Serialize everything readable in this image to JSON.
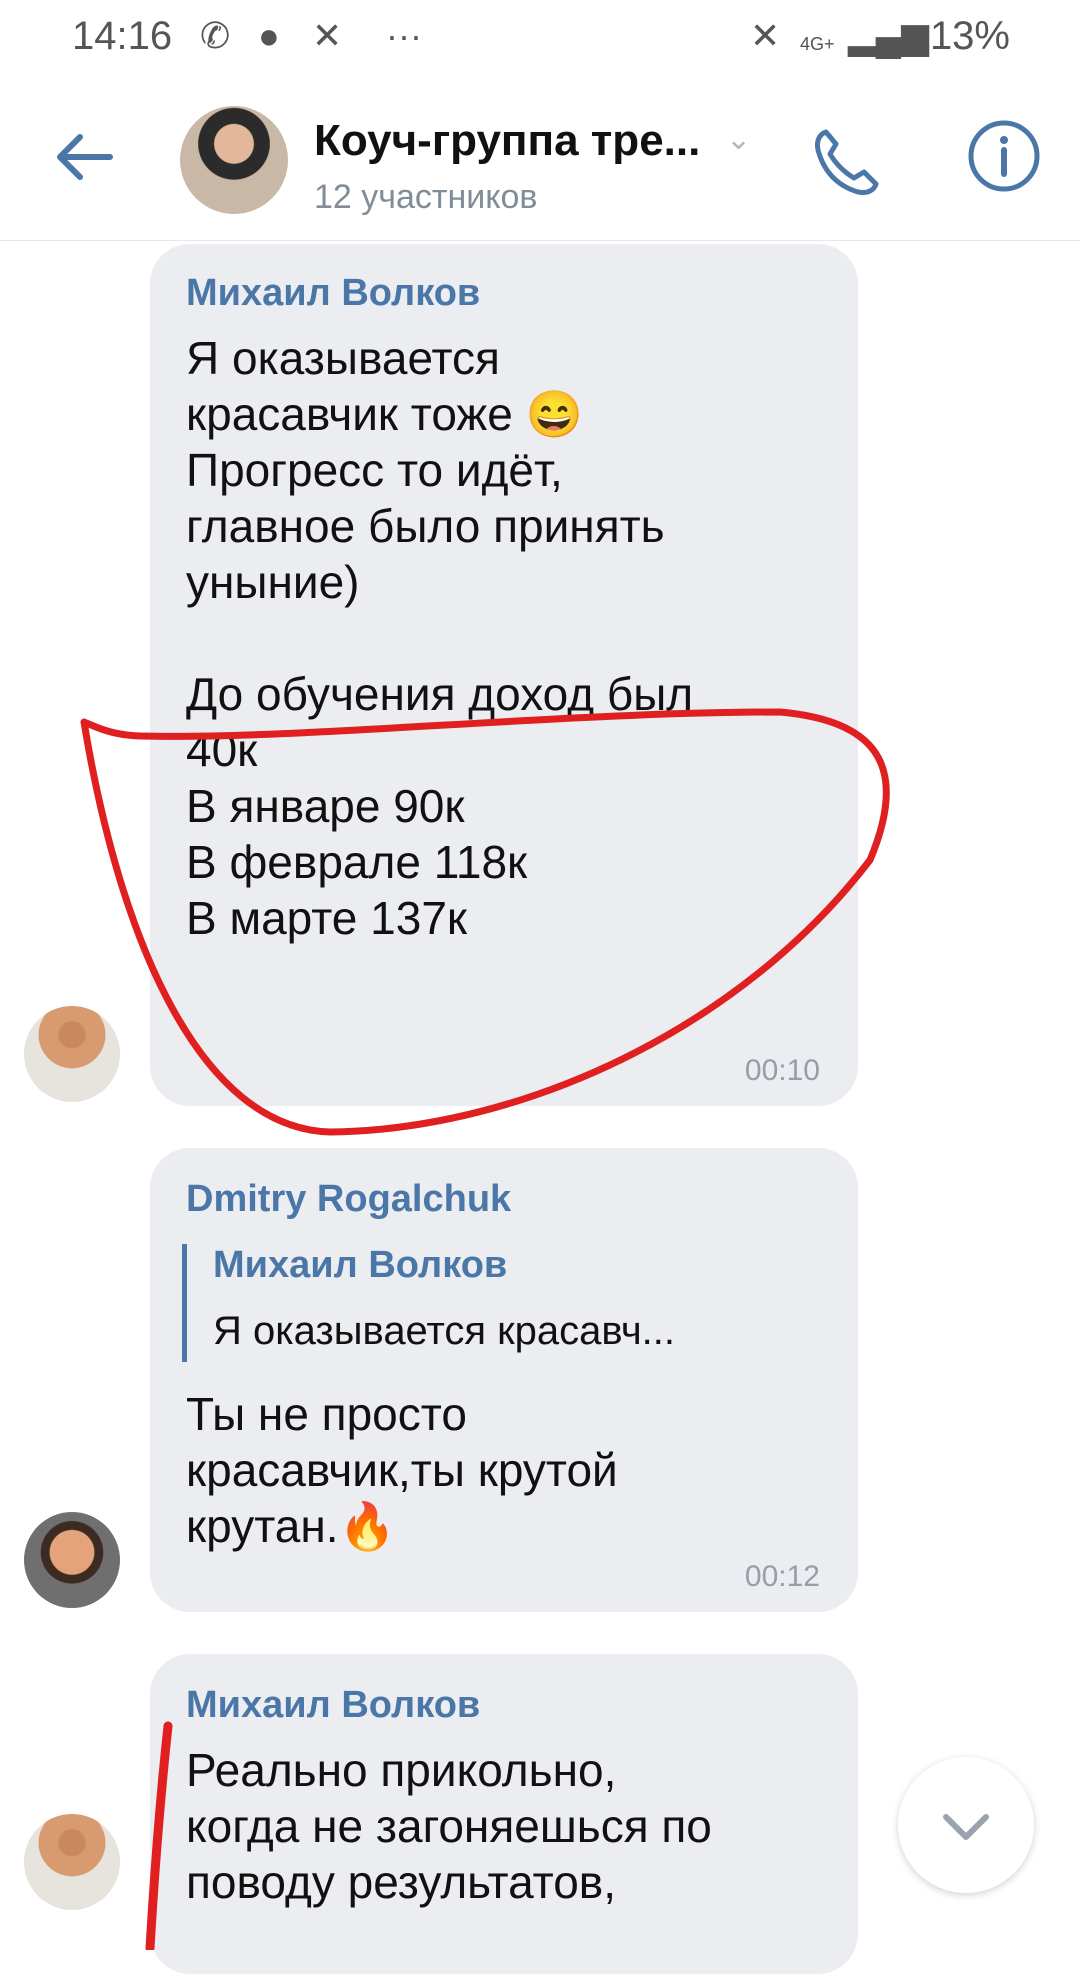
{
  "status_bar": {
    "time": "14:16",
    "icons_left": [
      "viber-icon",
      "chat-icon",
      "missed-call-icon",
      "more-icon"
    ],
    "network": "4G+",
    "battery": "13%"
  },
  "header": {
    "title": "Коуч-группа тре...",
    "subtitle": "12 участников",
    "colors": {
      "accent": "#4a76a8"
    }
  },
  "messages": [
    {
      "author": "Михаил Волков",
      "text": "Я оказывается\nкрасавчик тоже 😄\nПрогресс то идёт,\nглавное было принять\nуныние)\n\nДо обучения доход был\n40к\nВ январе 90к\nВ феврале 118к\nВ марте 137к",
      "time": "00:10"
    },
    {
      "author": "Dmitry Rogalchuk",
      "reply": {
        "author": "Михаил Волков",
        "text": "Я оказывается красавч..."
      },
      "text": "Ты не просто\nкрасавчик,ты крутой\nкрутан.🔥",
      "time": "00:12"
    },
    {
      "author": "Михаил Волков",
      "text": "Реально прикольно,\nкогда не загоняешься по\nповоду результатов,"
    }
  ]
}
